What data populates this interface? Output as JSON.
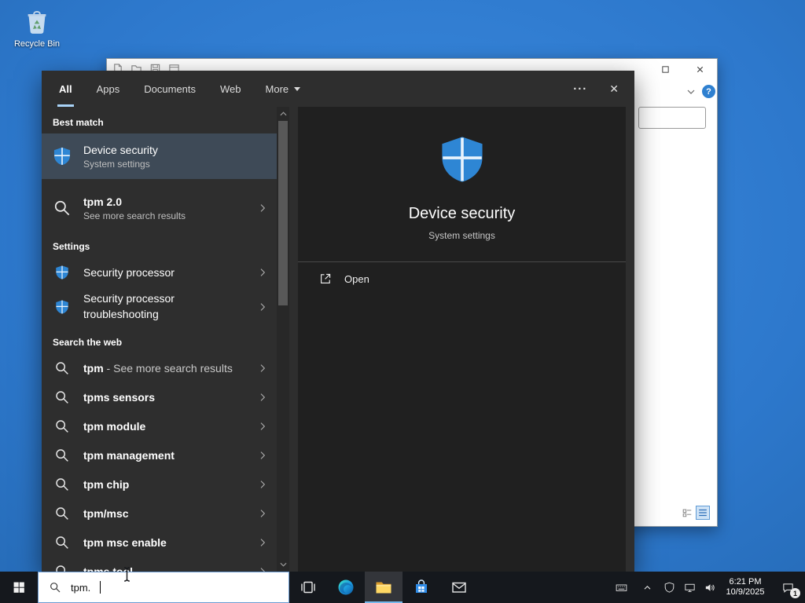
{
  "desktop": {
    "recycle_bin_label": "Recycle Bin",
    "wallpaper_color": "#2b77cf"
  },
  "background_window": {
    "help_label": "?"
  },
  "search": {
    "tabs": [
      {
        "label": "All",
        "active": true
      },
      {
        "label": "Apps",
        "active": false
      },
      {
        "label": "Documents",
        "active": false
      },
      {
        "label": "Web",
        "active": false
      },
      {
        "label": "More",
        "active": false,
        "has_dropdown": true
      }
    ],
    "overflow_label": "···",
    "close_label": "✕",
    "sections": {
      "best_match_header": "Best match",
      "best_match": {
        "title": "Device security",
        "subtitle": "System settings"
      },
      "see_more": {
        "title": "tpm 2.0",
        "subtitle": "See more search results"
      },
      "settings_header": "Settings",
      "settings_items": [
        {
          "label": "Security processor"
        },
        {
          "label": "Security processor troubleshooting"
        }
      ],
      "web_header": "Search the web",
      "web_items": [
        {
          "label": "tpm",
          "note": " - See more search results"
        },
        {
          "label": "tpms sensors"
        },
        {
          "label": "tpm module"
        },
        {
          "label": "tpm management"
        },
        {
          "label": "tpm chip"
        },
        {
          "label": "tpm/msc"
        },
        {
          "label": "tpm msc enable"
        },
        {
          "label": "tpms tool"
        }
      ]
    },
    "preview": {
      "title": "Device security",
      "subtitle": "System settings",
      "open_label": "Open"
    }
  },
  "taskbar": {
    "search_value": "tpm.",
    "clock": {
      "time": "6:21 PM",
      "date": "10/9/2025"
    },
    "notification_badge": "1"
  },
  "icons": {
    "search": "magnifier",
    "security_shield": "blue-shield-four-panes",
    "chevron_right": "❯",
    "close": "✕",
    "more_caret": "▾",
    "overflow": "···",
    "open": "launch-arrow",
    "scroll_up": "▲",
    "scroll_down": "▼",
    "windows_logo": "four-panes",
    "task_view": "rect-stack",
    "edge": "swirl-circle",
    "file_explorer": "yellow-folder",
    "store": "shopping-bag",
    "mail": "envelope",
    "touch_keyboard": "keyboard",
    "hidden_icons": "⌃",
    "defender": "shield-outline",
    "network": "monitor",
    "volume": "speaker",
    "action_center": "speech-bubble",
    "help": "?",
    "maximize": "▢",
    "window_close": "✕",
    "text_cursor": "i-beam",
    "recycle_bin": "bin"
  },
  "colors": {
    "accent": "#0078d7",
    "shield_blue": "#2e86d4",
    "selection_bg": "#3e4a57",
    "flyout_bg": "#2e2e2e",
    "preview_bg": "#202020",
    "taskbar_bg": "#15181d",
    "folder_yellow": "#ffd864"
  }
}
